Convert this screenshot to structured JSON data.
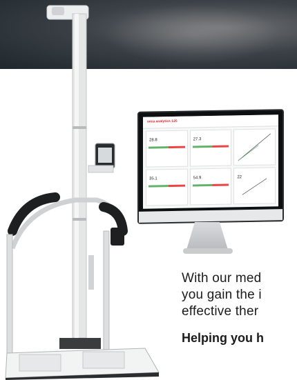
{
  "text_block": {
    "line1": "With our med",
    "line2": "you gain the i",
    "line3": "effective ther",
    "heading": "Helping you h"
  },
  "monitor": {
    "app_name": "seca analytics 125",
    "tiles": [
      {
        "value": "28.8"
      },
      {
        "value": "27.3"
      },
      {
        "value": ""
      },
      {
        "value": "35.1"
      },
      {
        "value": "54.9"
      },
      {
        "value": "22"
      }
    ]
  },
  "colors": {
    "accent_red": "#d22222",
    "green": "#62b36a"
  }
}
